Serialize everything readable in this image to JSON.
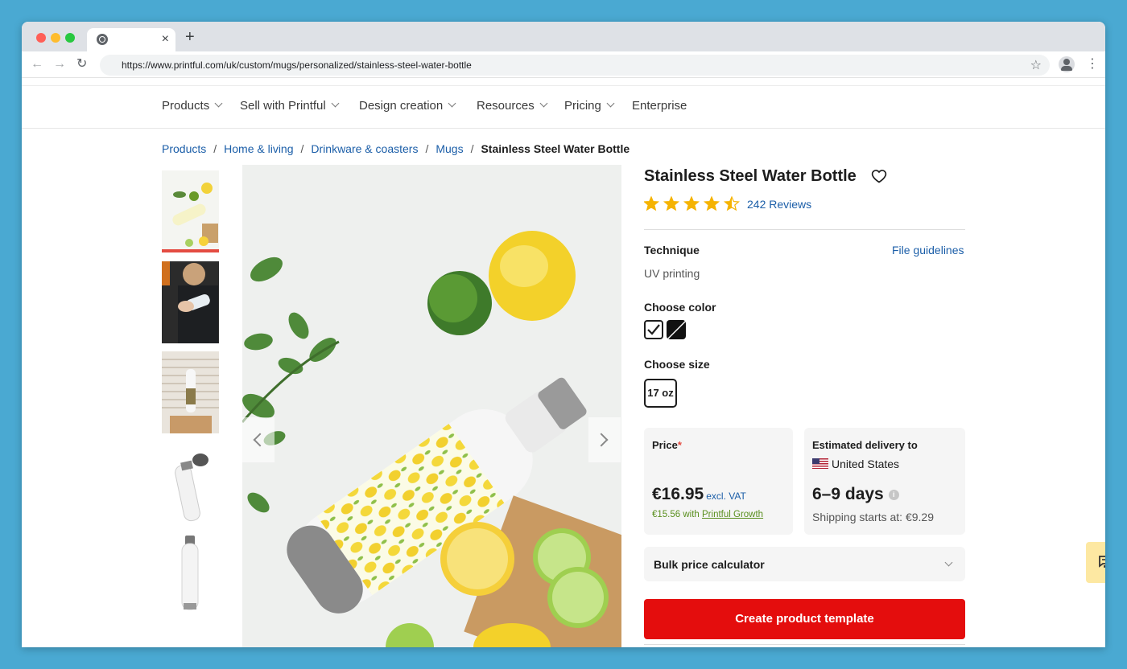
{
  "browser": {
    "tab": {
      "close": "×",
      "new_tab": "+"
    },
    "nav": {
      "back": "←",
      "forward": "→",
      "reload": "↻"
    },
    "url": "https://www.printful.com/uk/custom/mugs/personalized/stainless-steel-water-bottle",
    "bookmark_icon": "star-outline-icon",
    "menu": "⋮"
  },
  "site_nav": {
    "items": [
      {
        "label": "Products",
        "has_dropdown": true
      },
      {
        "label": "Sell with Printful",
        "has_dropdown": true
      },
      {
        "label": "Design creation",
        "has_dropdown": true
      },
      {
        "label": "Resources",
        "has_dropdown": true
      },
      {
        "label": "Pricing",
        "has_dropdown": true
      },
      {
        "label": "Enterprise",
        "has_dropdown": false
      }
    ]
  },
  "breadcrumb": {
    "items": [
      "Products",
      "Home & living",
      "Drinkware & coasters",
      "Mugs"
    ],
    "current": "Stainless Steel Water Bottle",
    "separator": "/"
  },
  "gallery": {
    "thumbnail_count": 5,
    "selected_index": 0,
    "prev_icon": "chevron-left-icon",
    "next_icon": "chevron-right-icon"
  },
  "product": {
    "title": "Stainless Steel Water Bottle",
    "rating": 4.5,
    "reviews": "242 Reviews",
    "technique_label": "Technique",
    "technique_value": "UV printing",
    "file_guidelines": "File guidelines",
    "color_label": "Choose color",
    "colors": [
      {
        "name": "White",
        "hex": "#ffffff",
        "selected": true
      },
      {
        "name": "Black",
        "hex": "#111111",
        "selected": false
      }
    ],
    "size_label": "Choose size",
    "sizes": [
      "17 oz"
    ],
    "selected_size": "17 oz"
  },
  "price_card": {
    "label": "Price",
    "required_mark": "*",
    "price": "€16.95",
    "vat_note": "excl. VAT",
    "growth_price": "€15.56 with ",
    "growth_link": "Printful Growth"
  },
  "delivery_card": {
    "label": "Estimated delivery to",
    "country": "United States",
    "days": "6–9 days",
    "info_icon": "i",
    "shipping": "Shipping starts at: €9.29"
  },
  "bulk_calculator": {
    "label": "Bulk price calculator"
  },
  "cta": {
    "label": "Create product template"
  },
  "colors": {
    "brand_red": "#e40d0d",
    "link_blue": "#1b5ea8",
    "star_yellow": "#f5b301",
    "growth_green": "#5a8f1f",
    "chat_bg": "#fde8a2",
    "desktop_bg": "#4aa9d2"
  },
  "chat": {
    "icon": "chat-bubbles-icon"
  }
}
